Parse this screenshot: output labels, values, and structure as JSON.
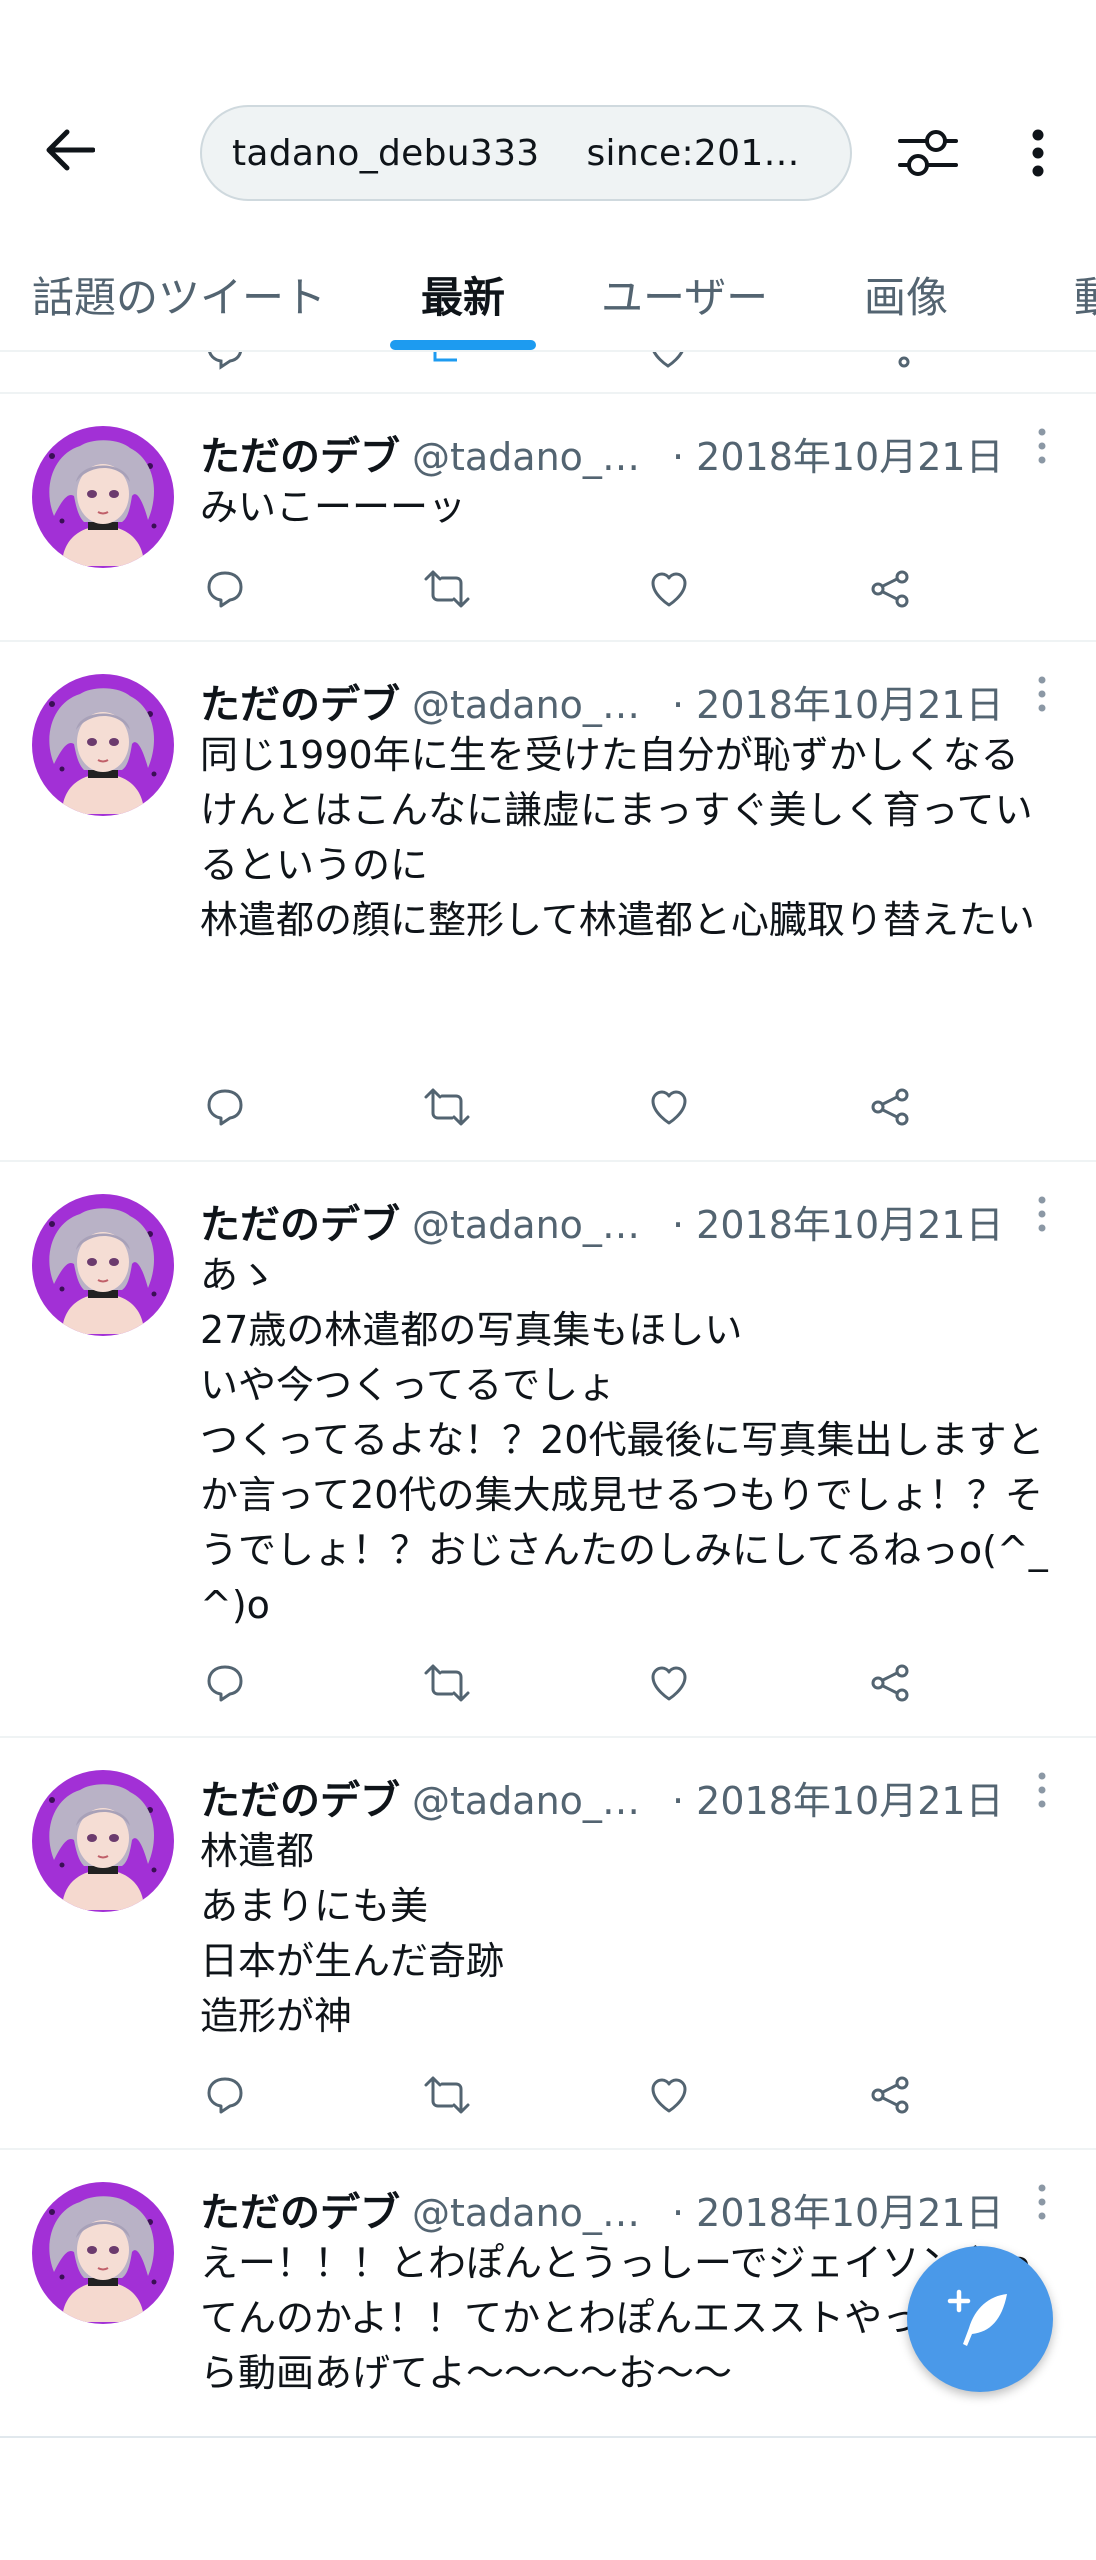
{
  "header": {
    "search_query": "tadano_debu333    since:201…"
  },
  "tabs": [
    {
      "label": "話題のツイート"
    },
    {
      "label": "最新"
    },
    {
      "label": "ユーザー"
    },
    {
      "label": "画像"
    },
    {
      "label": "動"
    }
  ],
  "colors": {
    "accent": "#1d9bf0",
    "fab": "#4a99e9",
    "secondary_text": "#536471",
    "avatar_bg": "#a230d6"
  },
  "tweets": [
    {
      "name": "ただのデブ",
      "handle": "@tadano_d...",
      "date": "· 2018年10月21日",
      "text": "みいこーーーッ"
    },
    {
      "name": "ただのデブ",
      "handle": "@tadano_d...",
      "date": "· 2018年10月21日",
      "text": "同じ1990年に生を受けた自分が恥ずかしくなる\nけんとはこんなに謙虚にまっすぐ美しく育っているというのに\n林遣都の顔に整形して林遣都と心臓取り替えたい"
    },
    {
      "name": "ただのデブ",
      "handle": "@tadano_d...",
      "date": "· 2018年10月21日",
      "text": "あゝ\n27歳の林遣都の写真集もほしい\nいや今つくってるでしょ\nつくってるよな！？20代最後に写真集出しますとか言って20代の集大成見せるつもりでしょ！？そうでしょ！？おじさんたのしみにしてるねっo(^_^)o"
    },
    {
      "name": "ただのデブ",
      "handle": "@tadano_d...",
      "date": "· 2018年10月21日",
      "text": "林遣都\nあまりにも美\n日本が生んだ奇跡\n造形が神"
    },
    {
      "name": "ただのデブ",
      "handle": "@tadano_d...",
      "date": "· 2018年10月21日",
      "text": "えー！！！とわぽんとうっしーでジェイソンやってんのかよ！！てかとわぽんエスストやってんなら動画あげてよ〜〜〜〜お〜〜"
    }
  ]
}
